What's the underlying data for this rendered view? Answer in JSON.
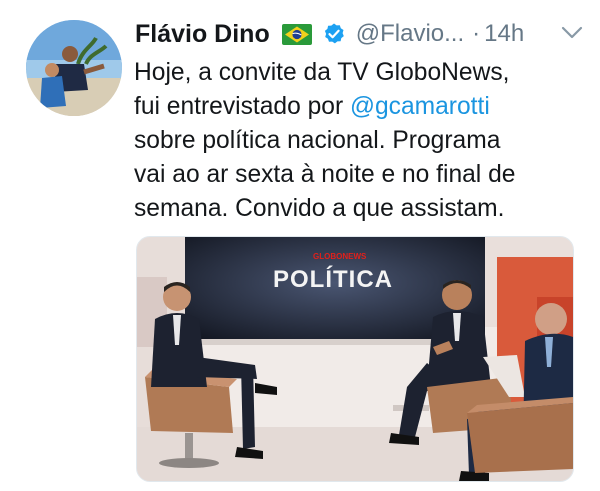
{
  "tweet": {
    "author_name": "Flávio Dino",
    "handle": "@Flavio...",
    "separator": "·",
    "time": "14h",
    "text_lines": [
      "Hoje, a convite da TV GloboNews,",
      "fui entrevistado por ",
      "sobre política nacional. Programa",
      "vai ao ar sexta à noite e no final de",
      "semana. Convido a que assistam."
    ],
    "mention": "@gcamarotti",
    "media": {
      "screen_brand": "GLOBONEWS",
      "screen_title": "POLÍTICA"
    }
  },
  "icons": {
    "flag": "brazil-flag-icon",
    "verified": "verified-badge-icon",
    "menu": "chevron-down-icon"
  },
  "colors": {
    "link": "#1b95e0",
    "secondary_text": "#657786",
    "verified": "#1da1f2",
    "screen_accent": "#e0201b"
  }
}
